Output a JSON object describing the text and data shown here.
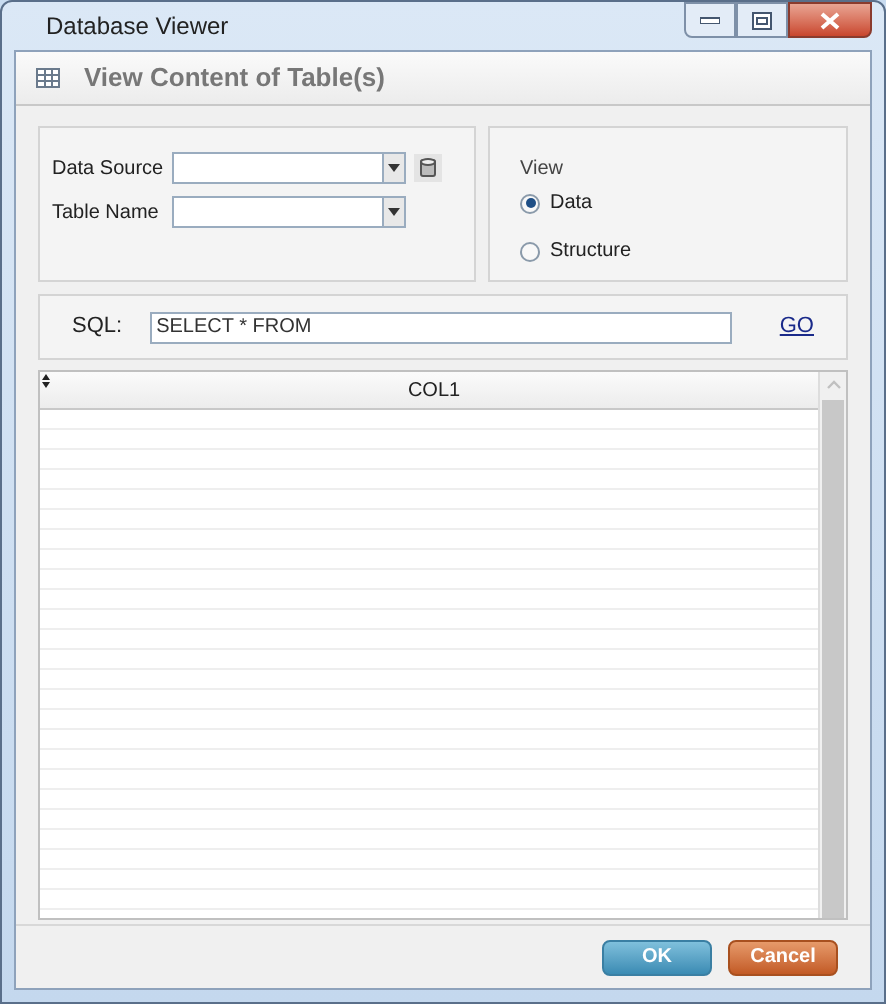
{
  "window": {
    "title": "Database Viewer"
  },
  "header": {
    "title": "View Content of Table(s)"
  },
  "fields": [
    {
      "label": "Data Source",
      "kind": "combo-db"
    },
    {
      "label": "Table Name",
      "kind": "combo"
    }
  ],
  "view": {
    "label": "View",
    "options": [
      {
        "label": "Data",
        "selected": true
      },
      {
        "label": "Structure",
        "selected": false
      }
    ]
  },
  "sql": {
    "label": "SQL:",
    "value": "SELECT * FROM",
    "link": "GO"
  },
  "grid": {
    "columns": [
      "COL1"
    ]
  },
  "buttons": [
    {
      "label": "OK",
      "kind": "primary"
    },
    {
      "label": "Cancel",
      "kind": "cancel"
    }
  ]
}
